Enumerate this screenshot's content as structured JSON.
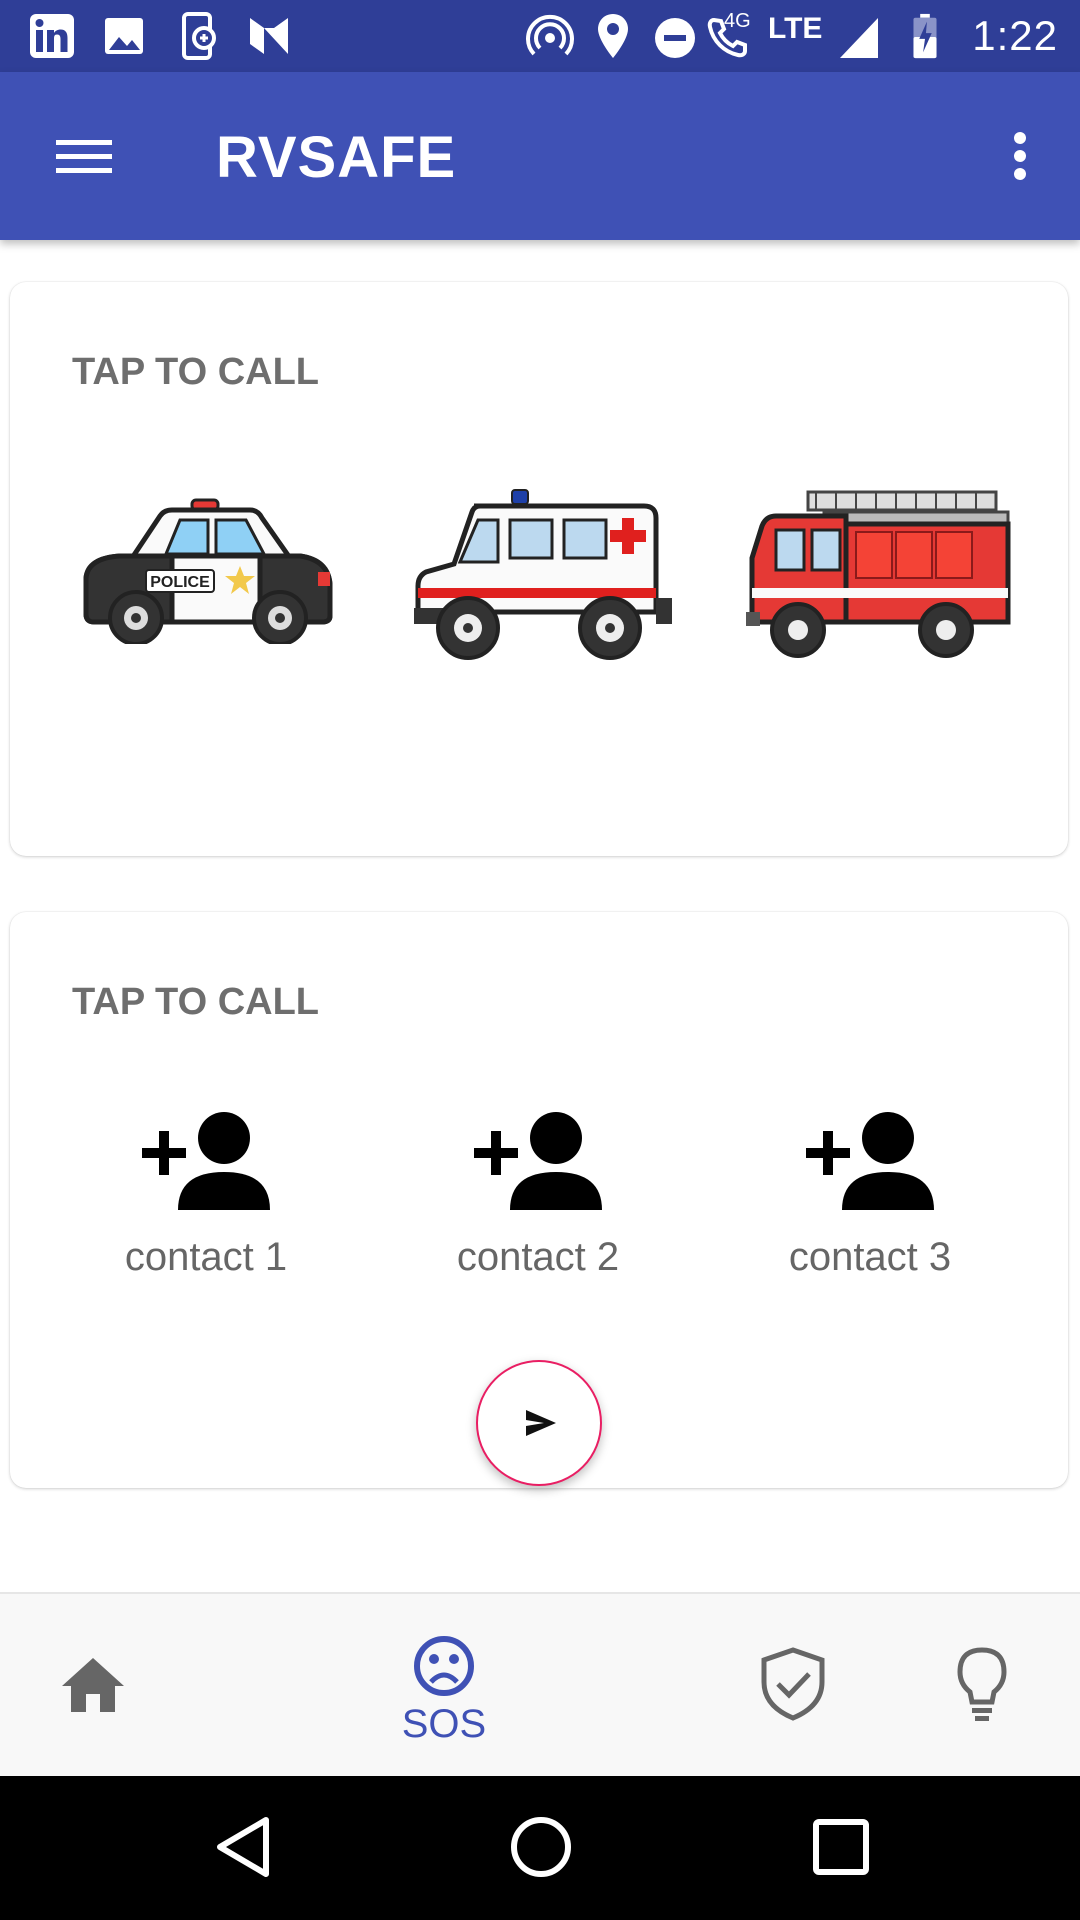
{
  "status_bar": {
    "time": "1:22",
    "network_label": "LTE",
    "network_type": "4G",
    "icons": [
      "linkedin-icon",
      "gallery-icon",
      "phone-sync-icon",
      "n-icon",
      "hotspot-icon",
      "location-icon",
      "do-not-disturb-icon",
      "wifi-calling-icon",
      "signal-icon",
      "battery-charging-icon"
    ]
  },
  "app_bar": {
    "title": "RVSAFE",
    "menu_icon": "hamburger-menu-icon",
    "overflow_icon": "more-vert-icon",
    "color": "#3f51b5"
  },
  "emergency_card": {
    "title": "TAP TO CALL",
    "services": [
      {
        "name": "police",
        "badge_text": "POLICE"
      },
      {
        "name": "ambulance"
      },
      {
        "name": "fire-truck"
      }
    ]
  },
  "contacts_card": {
    "title": "TAP TO CALL",
    "contacts": [
      {
        "label": "contact 1"
      },
      {
        "label": "contact 2"
      },
      {
        "label": "contact 3"
      }
    ],
    "fab_icon": "send-icon",
    "fab_border_color": "#e91e63"
  },
  "bottom_nav": {
    "items": [
      {
        "icon": "home-icon"
      },
      {
        "icon": "sad-face-icon",
        "label": "SOS",
        "active": true
      },
      {
        "icon": "shield-check-icon"
      },
      {
        "icon": "lightbulb-icon"
      }
    ],
    "active_color": "#3f51b5"
  },
  "system_nav": {
    "buttons": [
      "back-icon",
      "home-circle-icon",
      "recents-icon"
    ]
  }
}
